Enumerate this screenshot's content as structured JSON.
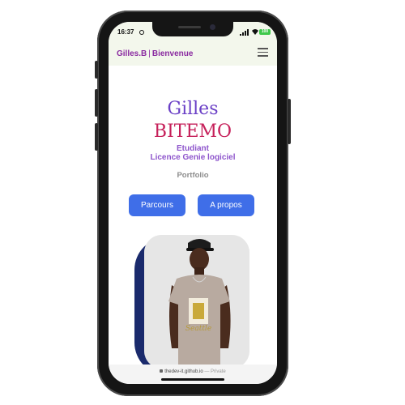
{
  "status_bar": {
    "time": "16:37",
    "battery_label": "100"
  },
  "navbar": {
    "brand_name": "Gilles.B",
    "brand_separator": "|",
    "brand_greeting": "Bienvenue",
    "menu_icon": "hamburger-menu-icon"
  },
  "hero": {
    "first_name": "Gilles",
    "last_name": "BITEMO",
    "role_line1": "Etudiant",
    "role_line2": "Licence Genie logiciel",
    "section_label": "Portfolio"
  },
  "buttons": {
    "parcours": "Parcours",
    "apropos": "A propos"
  },
  "browser": {
    "url": "thedev-it.github.io",
    "separator": " — ",
    "privacy": "Private"
  },
  "colors": {
    "brand": "#8a2aa0",
    "first_name": "#6a3fc6",
    "last_name": "#c6205a",
    "button": "#3f6ee8",
    "photo_backdrop": "#1a2a6c"
  }
}
